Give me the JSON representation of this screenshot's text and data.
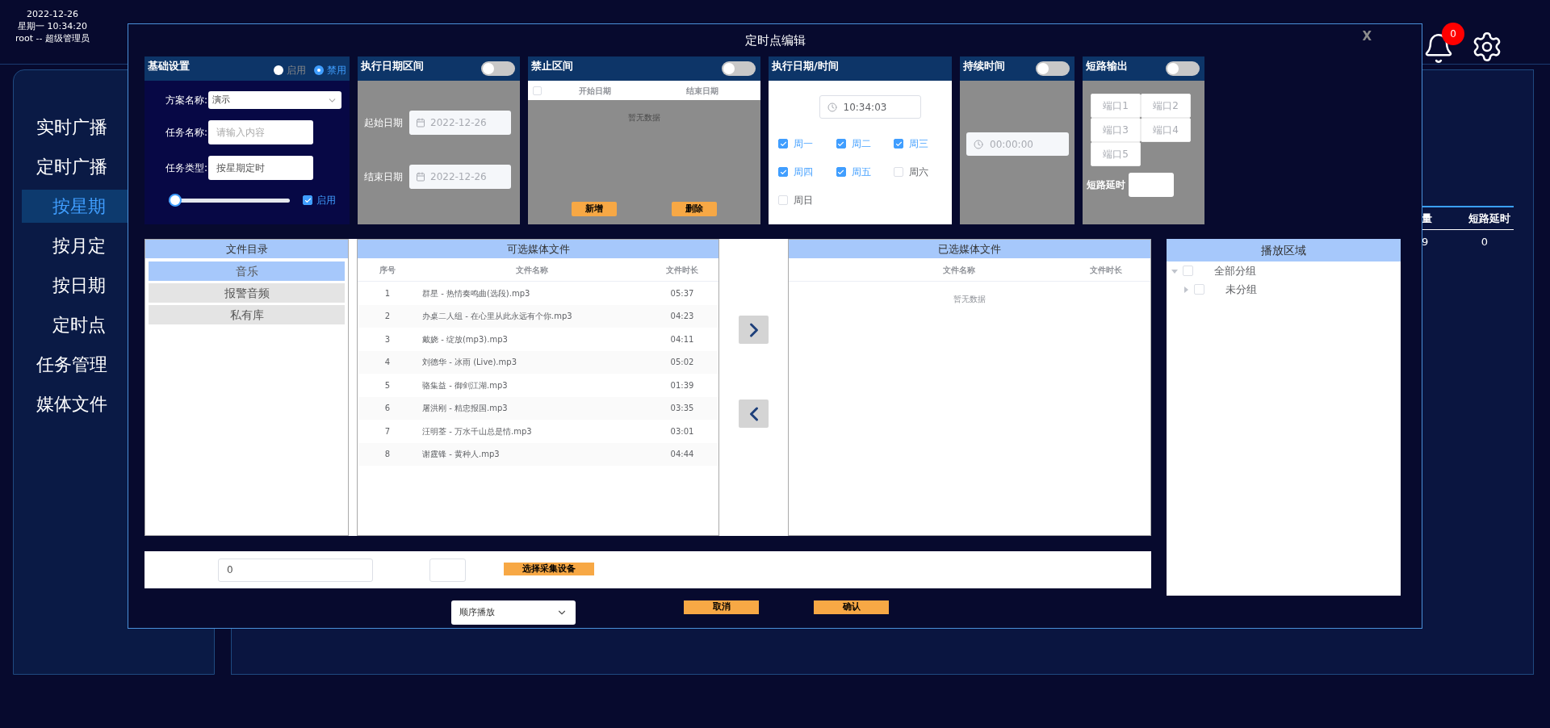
{
  "header": {
    "date": "2022-12-26",
    "time": "星期一 10:34:20",
    "user": "root -- 超级管理员",
    "notifications": "0"
  },
  "sidebar": {
    "items": [
      {
        "label": "实时广播",
        "selected": false
      },
      {
        "label": "定时广播",
        "selected": false,
        "children": [
          {
            "label": "按星期",
            "selected": true
          },
          {
            "label": "按月定",
            "selected": false
          },
          {
            "label": "按日期",
            "selected": false
          },
          {
            "label": "定时点",
            "selected": false
          }
        ]
      },
      {
        "label": "任务管理",
        "selected": false
      },
      {
        "label": "媒体文件",
        "selected": false
      }
    ]
  },
  "background_table": {
    "columns": [
      "量",
      "短路延时"
    ],
    "row": [
      "9",
      "0"
    ]
  },
  "dialog": {
    "title": "定时点编辑",
    "close": "X",
    "basic": {
      "title": "基础设置",
      "mode_options": [
        {
          "label": "启用",
          "selected": false
        },
        {
          "label": "禁用",
          "selected": true
        }
      ],
      "fields": [
        {
          "label": "方案名称:",
          "kind": "select",
          "value": "演示"
        },
        {
          "label": "任务名称:",
          "kind": "input",
          "placeholder": "请输入内容"
        },
        {
          "label": "任务类型:",
          "kind": "input",
          "value": "按星期定时"
        }
      ],
      "volume": {
        "level": 0
      },
      "enable": {
        "label": "启用",
        "checked": true
      }
    },
    "date_range": {
      "title": "执行日期区间",
      "on": false,
      "fields": [
        {
          "label": "起始日期",
          "value": "2022-12-26"
        },
        {
          "label": "结束日期",
          "value": "2022-12-26"
        }
      ]
    },
    "blocked": {
      "title": "禁止区间",
      "on": false,
      "all_checked": false,
      "columns": [
        "开始日期",
        "结束日期"
      ],
      "empty_text": "暂无数据",
      "buttons": [
        "新增",
        "删除"
      ]
    },
    "schedule": {
      "title": "执行日期/时间",
      "time": "10:34:03",
      "days": [
        {
          "label": "周一",
          "checked": true
        },
        {
          "label": "周二",
          "checked": true
        },
        {
          "label": "周三",
          "checked": true
        },
        {
          "label": "周四",
          "checked": true
        },
        {
          "label": "周五",
          "checked": true
        },
        {
          "label": "周六",
          "checked": false
        },
        {
          "label": "周日",
          "checked": false
        }
      ]
    },
    "duration": {
      "title": "持续时间",
      "on": false,
      "value": "00:00:00"
    },
    "short_circuit": {
      "title": "短路输出",
      "on": false,
      "ports": [
        "端口1",
        "端口2",
        "端口3",
        "端口4",
        "端口5"
      ],
      "delay_label": "短路延时"
    },
    "directory": {
      "title": "文件目录",
      "items": [
        {
          "label": "音乐",
          "selected": true
        },
        {
          "label": "报警音频",
          "selected": false
        },
        {
          "label": "私有库",
          "selected": false
        }
      ]
    },
    "available": {
      "title": "可选媒体文件",
      "columns": [
        "序号",
        "文件名称",
        "文件时长"
      ],
      "rows": [
        {
          "no": "1",
          "name": "群星 - 热情奏鸣曲(选段).mp3",
          "duration": "05:37"
        },
        {
          "no": "2",
          "name": "办桌二人组 - 在心里从此永远有个你.mp3",
          "duration": "04:23"
        },
        {
          "no": "3",
          "name": "戴娆 - 绽放(mp3).mp3",
          "duration": "04:11"
        },
        {
          "no": "4",
          "name": "刘德华 - 冰雨 (Live).mp3",
          "duration": "05:02"
        },
        {
          "no": "5",
          "name": "骆集益 - 御剑江湖.mp3",
          "duration": "01:39"
        },
        {
          "no": "6",
          "name": "屠洪刚 - 精忠报国.mp3",
          "duration": "03:35"
        },
        {
          "no": "7",
          "name": "汪明荃 - 万水千山总是情.mp3",
          "duration": "03:01"
        },
        {
          "no": "8",
          "name": "谢霆锋 - 黄种人.mp3",
          "duration": "04:44"
        }
      ]
    },
    "selected_files": {
      "title": "已选媒体文件",
      "columns": [
        "文件名称",
        "文件时长"
      ],
      "empty_text": "暂无数据"
    },
    "zones": {
      "title": "播放区域",
      "tree": [
        {
          "label": "全部分组",
          "expanded": true,
          "checked": false,
          "children": [
            {
              "label": "未分组",
              "expanded": false,
              "checked": false
            }
          ]
        }
      ]
    },
    "device": {
      "value": "0",
      "button": "选择采集设备"
    },
    "play_mode": "顺序播放",
    "actions": [
      "取消",
      "确认"
    ]
  }
}
